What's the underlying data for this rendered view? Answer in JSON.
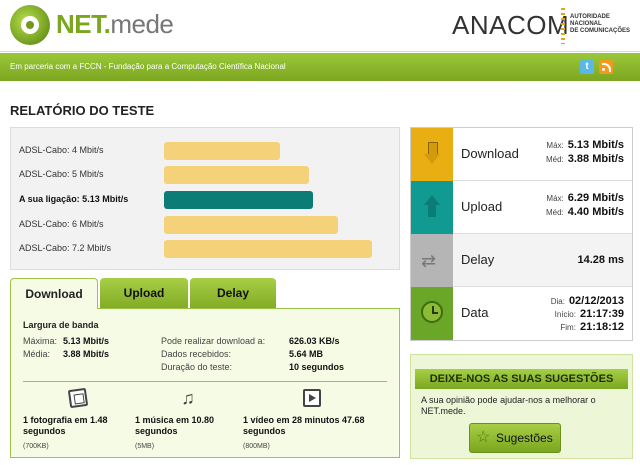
{
  "header": {
    "logo_main": "NET.",
    "logo_sub": "mede",
    "partner_name": "ANACOM",
    "partner_sub": [
      "AUTORIDADE",
      "NACIONAL",
      "DE COMUNICAÇÕES"
    ]
  },
  "banner": {
    "text": "Em parceria com a FCCN - Fundação para a Computação Científica Nacional",
    "twitter_glyph": "t"
  },
  "title": "RELATÓRIO DO TESTE",
  "comparison": {
    "max_value": 7.6,
    "rows": [
      {
        "label": "ADSL-Cabo: 4 Mbit/s",
        "value": 4.0,
        "highlight": false
      },
      {
        "label": "ADSL-Cabo: 5 Mbit/s",
        "value": 5.0,
        "highlight": false
      },
      {
        "label": "A sua ligação: 5.13 Mbit/s",
        "value": 5.13,
        "highlight": true
      },
      {
        "label": "ADSL-Cabo: 6 Mbit/s",
        "value": 6.0,
        "highlight": false
      },
      {
        "label": "ADSL-Cabo: 7.2 Mbit/s",
        "value": 7.2,
        "highlight": false
      }
    ],
    "colors": {
      "normal": "#f5d27a",
      "highlight": "#0c7d76"
    }
  },
  "tabs": [
    {
      "label": "Download",
      "active": true
    },
    {
      "label": "Upload",
      "active": false
    },
    {
      "label": "Delay",
      "active": false
    }
  ],
  "download_panel": {
    "title": "Largura de banda",
    "max_label": "Máxima:",
    "max_value": "5.13 Mbit/s",
    "avg_label": "Média:",
    "avg_value": "3.88 Mbit/s",
    "rate_label": "Pode realizar download a:",
    "rate_value": "626.03 KB/s",
    "received_label": "Dados recebidos:",
    "received_value": "5.64 MB",
    "duration_label": "Duração do teste:",
    "duration_value": "10 segundos",
    "media": [
      {
        "line1": "1 fotografia em 1.48",
        "line2": "segundos",
        "size": "(700KB)"
      },
      {
        "line1": "1 música em 10.80",
        "line2": "segundos",
        "size": "(5MB)"
      },
      {
        "line1": "1 vídeo em 28 minutos 47.68",
        "line2": "segundos",
        "size": "(800MB)"
      }
    ]
  },
  "results": {
    "download": {
      "label": "Download",
      "max_label": "Máx:",
      "max": "5.13 Mbit/s",
      "avg_label": "Méd:",
      "avg": "3.88 Mbit/s",
      "color": "#e8ae12"
    },
    "upload": {
      "label": "Upload",
      "max_label": "Máx:",
      "max": "6.29 Mbit/s",
      "avg_label": "Méd:",
      "avg": "4.40 Mbit/s",
      "color": "#119a92"
    },
    "delay": {
      "label": "Delay",
      "value": "14.28 ms",
      "color": "#b5b5b5"
    },
    "data": {
      "label": "Data",
      "day_label": "Dia:",
      "day": "02/12/2013",
      "start_label": "Início:",
      "start": "21:17:39",
      "end_label": "Fim:",
      "end": "21:18:12",
      "color": "#6aa728"
    }
  },
  "suggestions": {
    "heading": "DEIXE-NOS AS SUAS SUGESTÕES",
    "text": "A sua opinião pode ajudar-nos a melhorar o NET.mede.",
    "button": "Sugestões"
  }
}
